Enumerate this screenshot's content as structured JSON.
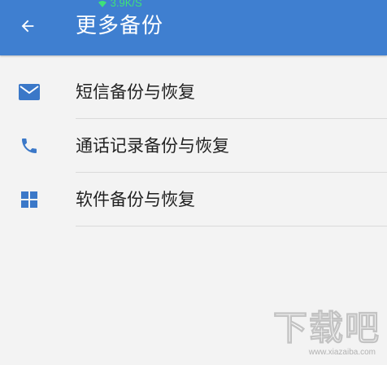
{
  "status_bar": {
    "network_speed": "3.9K/S",
    "speed_color": "#3fe07a"
  },
  "header": {
    "title": "更多备份",
    "back_icon": "arrow-back-icon",
    "background_color": "#3f7fd0"
  },
  "menu": {
    "items": [
      {
        "label": "短信备份与恢复",
        "icon": "envelope-icon"
      },
      {
        "label": "通话记录备份与恢复",
        "icon": "phone-icon"
      },
      {
        "label": "软件备份与恢复",
        "icon": "windows-grid-icon"
      }
    ],
    "icon_color": "#3b78c8"
  },
  "watermark": {
    "brand": "下载吧",
    "url": "www.xiazaiba.com"
  }
}
